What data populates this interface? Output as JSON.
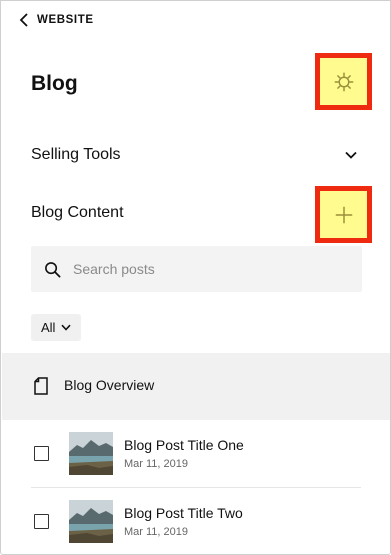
{
  "nav": {
    "back_label": "WEBSITE"
  },
  "header": {
    "title": "Blog"
  },
  "sections": {
    "selling_tools": "Selling Tools",
    "blog_content": "Blog Content"
  },
  "search": {
    "placeholder": "Search posts",
    "value": ""
  },
  "filter": {
    "selected": "All"
  },
  "overview": {
    "label": "Blog Overview"
  },
  "posts": [
    {
      "title": "Blog Post Title One",
      "date": "Mar 11, 2019"
    },
    {
      "title": "Blog Post Title Two",
      "date": "Mar 11, 2019"
    }
  ],
  "icons": {
    "back": "chevron-left-icon",
    "settings": "gear-icon",
    "expand": "chevron-down-icon",
    "add": "plus-icon",
    "search": "search-icon",
    "filter": "chevron-down-icon",
    "page": "page-icon"
  },
  "colors": {
    "highlight_fill": "#fffb8f",
    "highlight_border": "#ee2b10",
    "row_highlight": "#f1f1f1",
    "search_bg": "#f2f3f2"
  }
}
